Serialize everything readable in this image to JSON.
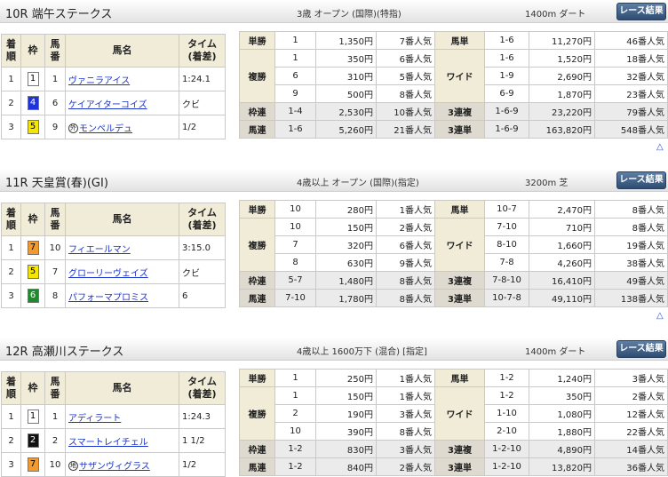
{
  "headers": {
    "finish": "着\n順",
    "frame": "枠",
    "horse_num": "馬\n番",
    "horse_name": "馬名",
    "time": "タイム\n(着差)"
  },
  "button_label": "レース結果",
  "scroll_up": "△",
  "races": [
    {
      "title": "10R 端午ステークス",
      "cond": "3歳 オープン (国際)(特指)",
      "dist": "1400m  ダート",
      "results": [
        {
          "pos": "1",
          "frame": "1",
          "frame_bg": "#ffffff",
          "frame_fg": "#000000",
          "num": "1",
          "mark": "",
          "horse": "ヴァニラアイス",
          "time": "1:24.1"
        },
        {
          "pos": "2",
          "frame": "4",
          "frame_bg": "#1f33d9",
          "frame_fg": "#ffffff",
          "num": "6",
          "mark": "",
          "horse": "ケイアイターコイズ",
          "time": "クビ"
        },
        {
          "pos": "3",
          "frame": "5",
          "frame_bg": "#f4e600",
          "frame_fg": "#000000",
          "num": "9",
          "mark": "外",
          "horse": "モンペルデュ",
          "time": "1/2"
        }
      ],
      "payouts": {
        "tansho": {
          "label": "単勝",
          "num": "1",
          "pay": "1,350円",
          "pop": "7番人気"
        },
        "fukusho": {
          "label": "複勝",
          "rows": [
            {
              "num": "1",
              "pay": "350円",
              "pop": "6番人気"
            },
            {
              "num": "6",
              "pay": "310円",
              "pop": "5番人気"
            },
            {
              "num": "9",
              "pay": "500円",
              "pop": "8番人気"
            }
          ]
        },
        "wakuren": {
          "label": "枠連",
          "num": "1-4",
          "pay": "2,530円",
          "pop": "10番人気"
        },
        "umaren": {
          "label": "馬連",
          "num": "1-6",
          "pay": "5,260円",
          "pop": "21番人気"
        },
        "umatan": {
          "label": "馬単",
          "num": "1-6",
          "pay": "11,270円",
          "pop": "46番人気"
        },
        "wide": {
          "label": "ワイド",
          "rows": [
            {
              "num": "1-6",
              "pay": "1,520円",
              "pop": "18番人気"
            },
            {
              "num": "1-9",
              "pay": "2,690円",
              "pop": "32番人気"
            },
            {
              "num": "6-9",
              "pay": "1,870円",
              "pop": "23番人気"
            }
          ]
        },
        "sanrenpuku": {
          "label": "3連複",
          "num": "1-6-9",
          "pay": "23,220円",
          "pop": "79番人気"
        },
        "sanrentan": {
          "label": "3連単",
          "num": "1-6-9",
          "pay": "163,820円",
          "pop": "548番人気"
        }
      }
    },
    {
      "title": "11R 天皇賞(春)(GⅠ)",
      "cond": "4歳以上 オープン (国際)(指定)",
      "dist": "3200m  芝",
      "results": [
        {
          "pos": "1",
          "frame": "7",
          "frame_bg": "#f39a2e",
          "frame_fg": "#000000",
          "num": "10",
          "mark": "",
          "horse": "フィエールマン",
          "time": "3:15.0"
        },
        {
          "pos": "2",
          "frame": "5",
          "frame_bg": "#f4e600",
          "frame_fg": "#000000",
          "num": "7",
          "mark": "",
          "horse": "グローリーヴェイズ",
          "time": "クビ"
        },
        {
          "pos": "3",
          "frame": "6",
          "frame_bg": "#1e8a2e",
          "frame_fg": "#ffffff",
          "num": "8",
          "mark": "",
          "horse": "パフォーマプロミス",
          "time": "6"
        }
      ],
      "payouts": {
        "tansho": {
          "label": "単勝",
          "num": "10",
          "pay": "280円",
          "pop": "1番人気"
        },
        "fukusho": {
          "label": "複勝",
          "rows": [
            {
              "num": "10",
              "pay": "150円",
              "pop": "2番人気"
            },
            {
              "num": "7",
              "pay": "320円",
              "pop": "6番人気"
            },
            {
              "num": "8",
              "pay": "630円",
              "pop": "9番人気"
            }
          ]
        },
        "wakuren": {
          "label": "枠連",
          "num": "5-7",
          "pay": "1,480円",
          "pop": "8番人気"
        },
        "umaren": {
          "label": "馬連",
          "num": "7-10",
          "pay": "1,780円",
          "pop": "8番人気"
        },
        "umatan": {
          "label": "馬単",
          "num": "10-7",
          "pay": "2,470円",
          "pop": "8番人気"
        },
        "wide": {
          "label": "ワイド",
          "rows": [
            {
              "num": "7-10",
              "pay": "710円",
              "pop": "8番人気"
            },
            {
              "num": "8-10",
              "pay": "1,660円",
              "pop": "19番人気"
            },
            {
              "num": "7-8",
              "pay": "4,260円",
              "pop": "38番人気"
            }
          ]
        },
        "sanrenpuku": {
          "label": "3連複",
          "num": "7-8-10",
          "pay": "16,410円",
          "pop": "49番人気"
        },
        "sanrentan": {
          "label": "3連単",
          "num": "10-7-8",
          "pay": "49,110円",
          "pop": "138番人気"
        }
      }
    },
    {
      "title": "12R 高瀬川ステークス",
      "cond": "4歳以上 1600万下 (混合) [指定]",
      "dist": "1400m  ダート",
      "results": [
        {
          "pos": "1",
          "frame": "1",
          "frame_bg": "#ffffff",
          "frame_fg": "#000000",
          "num": "1",
          "mark": "",
          "horse": "アディラート",
          "time": "1:24.3"
        },
        {
          "pos": "2",
          "frame": "2",
          "frame_bg": "#111111",
          "frame_fg": "#ffffff",
          "num": "2",
          "mark": "",
          "horse": "スマートレイチェル",
          "time": "1 1/2"
        },
        {
          "pos": "3",
          "frame": "7",
          "frame_bg": "#f39a2e",
          "frame_fg": "#000000",
          "num": "10",
          "mark": "地",
          "horse": "サザンヴィグラス",
          "time": "1/2"
        }
      ],
      "payouts": {
        "tansho": {
          "label": "単勝",
          "num": "1",
          "pay": "250円",
          "pop": "1番人気"
        },
        "fukusho": {
          "label": "複勝",
          "rows": [
            {
              "num": "1",
              "pay": "150円",
              "pop": "1番人気"
            },
            {
              "num": "2",
              "pay": "190円",
              "pop": "3番人気"
            },
            {
              "num": "10",
              "pay": "390円",
              "pop": "8番人気"
            }
          ]
        },
        "wakuren": {
          "label": "枠連",
          "num": "1-2",
          "pay": "830円",
          "pop": "3番人気"
        },
        "umaren": {
          "label": "馬連",
          "num": "1-2",
          "pay": "840円",
          "pop": "2番人気"
        },
        "umatan": {
          "label": "馬単",
          "num": "1-2",
          "pay": "1,240円",
          "pop": "3番人気"
        },
        "wide": {
          "label": "ワイド",
          "rows": [
            {
              "num": "1-2",
              "pay": "350円",
              "pop": "2番人気"
            },
            {
              "num": "1-10",
              "pay": "1,080円",
              "pop": "12番人気"
            },
            {
              "num": "2-10",
              "pay": "1,880円",
              "pop": "22番人気"
            }
          ]
        },
        "sanrenpuku": {
          "label": "3連複",
          "num": "1-2-10",
          "pay": "4,890円",
          "pop": "14番人気"
        },
        "sanrentan": {
          "label": "3連単",
          "num": "1-2-10",
          "pay": "13,820円",
          "pop": "36番人気"
        }
      }
    }
  ]
}
